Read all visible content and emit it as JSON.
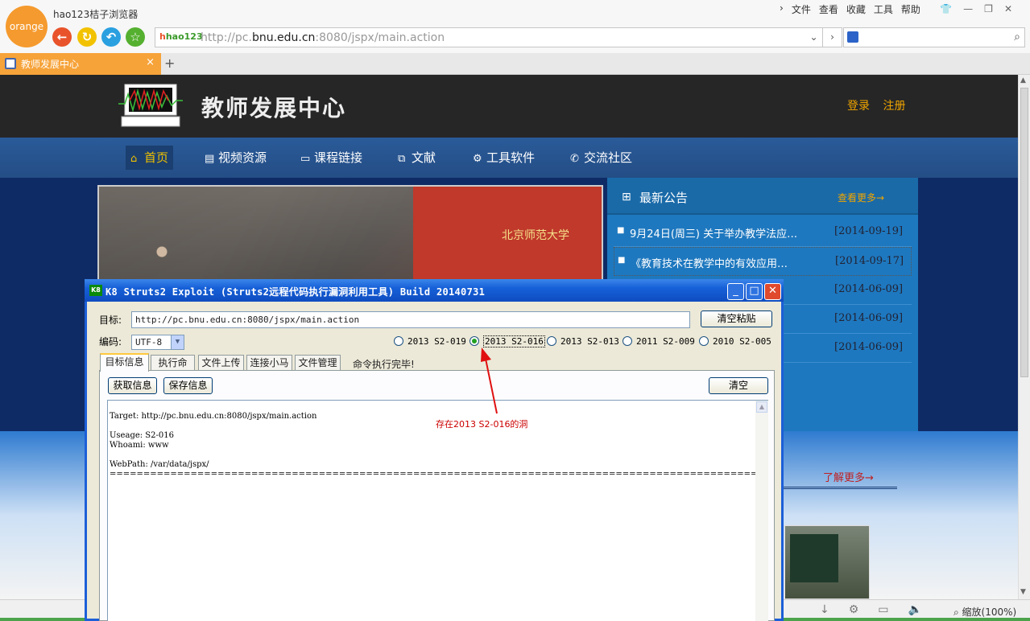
{
  "browser": {
    "logo_text": "orange",
    "app_title": "hao123桔子浏览器",
    "menu": [
      "文件",
      "查看",
      "收藏",
      "工具",
      "帮助"
    ],
    "url_logo": "hao123",
    "url_prefix": "http://pc.",
    "url_host": "bnu.edu.cn",
    "url_suffix": ":8080/jspx/main.action",
    "tab_label": "教师发展中心",
    "tab_close": "×",
    "tab_add": "+",
    "zoom_label": "缩放(100%)"
  },
  "site": {
    "title": "教师发展中心",
    "login": "登录",
    "register": "注册",
    "nav": [
      {
        "label": "首页",
        "icon": "home-icon"
      },
      {
        "label": "视频资源",
        "icon": "film-icon"
      },
      {
        "label": "课程链接",
        "icon": "monitor-icon"
      },
      {
        "label": "文献",
        "icon": "documents-icon"
      },
      {
        "label": "工具软件",
        "icon": "gear-icon"
      },
      {
        "label": "交流社区",
        "icon": "phone-icon"
      }
    ],
    "banner_text": "北京师范大学",
    "notice": {
      "title": "最新公告",
      "more": "查看更多→",
      "items": [
        {
          "title": "9月24日(周三) 关于举办教学法应…",
          "date": "[2014-09-19]"
        },
        {
          "title": "《教育技术在教学中的有效应用…",
          "date": "[2014-09-17]"
        },
        {
          "title": "",
          "date": "[2014-06-09]"
        },
        {
          "title": "",
          "date": "[2014-06-09]"
        },
        {
          "title": "",
          "date": "[2014-06-09]"
        }
      ]
    },
    "learn_more": "了解更多→"
  },
  "dialog": {
    "title": "K8 Struts2 Exploit (Struts2远程代码执行漏洞利用工具)  Build 20140731",
    "icon_text": "K8",
    "target_label": "目标:",
    "target_value": "http://pc.bnu.edu.cn:8080/jspx/main.action",
    "paste_button": "清空粘贴",
    "encoding_label": "编码:",
    "encoding_value": "UTF-8",
    "radios": [
      {
        "label": "2013 S2-019",
        "checked": false
      },
      {
        "label": "2013 S2-016",
        "checked": true
      },
      {
        "label": "2013 S2-013",
        "checked": false
      },
      {
        "label": "2011 S2-009",
        "checked": false
      },
      {
        "label": "2010 S2-005",
        "checked": false
      }
    ],
    "tabs": [
      "目标信息",
      "执行命令",
      "文件上传",
      "连接小马",
      "文件管理"
    ],
    "status": "命令执行完毕!",
    "get_info": "获取信息",
    "save_info": "保存信息",
    "clear": "清空",
    "output": "Target: http://pc.bnu.edu.cn:8080/jspx/main.action\n\nUseage: S2-016\nWhoami: www\n\nWebPath: /var/data/jspx/\n=============================================================================================================================================================================================="
  },
  "annotation": {
    "text": "存在2013 S2-016的洞",
    "color": "#cc0000"
  }
}
